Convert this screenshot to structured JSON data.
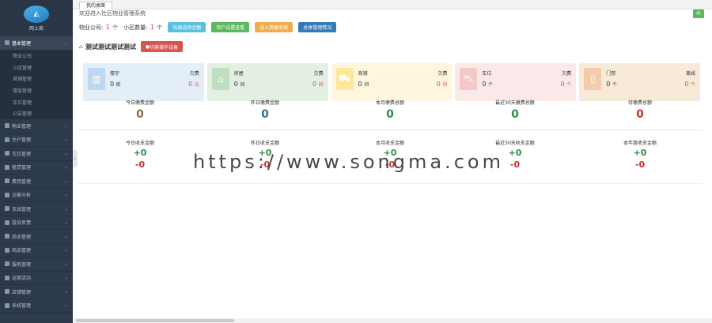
{
  "sidebar": {
    "logo_text": "网上商",
    "items": [
      {
        "label": "基本管理",
        "active": true
      },
      {
        "label": "物业公司",
        "sub": true
      },
      {
        "label": "小区管理",
        "sub": true
      },
      {
        "label": "商铺管理",
        "sub": true
      },
      {
        "label": "楼层管理",
        "sub": true
      },
      {
        "label": "车位管理",
        "sub": true
      },
      {
        "label": "公告管理",
        "sub": true
      },
      {
        "label": "物业管理"
      },
      {
        "label": "住户管理"
      },
      {
        "label": "车位管理"
      },
      {
        "label": "租赁管理"
      },
      {
        "label": "费用管理"
      },
      {
        "label": "访客分析"
      },
      {
        "label": "支出管理"
      },
      {
        "label": "投诉反馈"
      },
      {
        "label": "商业管理"
      },
      {
        "label": "商品管理"
      },
      {
        "label": "服务管理"
      },
      {
        "label": "运营活动"
      },
      {
        "label": "店铺管理"
      },
      {
        "label": "系统管理"
      }
    ]
  },
  "tabs": {
    "home": "我的桌面"
  },
  "header": {
    "welcome": "欢迎进入社区物业管理系统",
    "company_label": "物业公司:",
    "company_count": "1",
    "unit1": "个",
    "community_label": "小区数量:",
    "community_count": "1",
    "unit2": "个",
    "buttons": [
      "快速选择金额",
      "用户设置查看",
      "进入数据系统",
      "总体管理情况"
    ]
  },
  "project": {
    "title": "测试测试测试测试",
    "button": "切换操作设备"
  },
  "cards": [
    {
      "icon": "building-icon",
      "label": "楼宇",
      "value": "0",
      "unit": "栋",
      "label2": "欠费",
      "value2": "0",
      "unit2": "元"
    },
    {
      "icon": "house-icon",
      "label": "房屋",
      "value": "0",
      "unit": "间",
      "label2": "欠费",
      "value2": "0",
      "unit2": "间"
    },
    {
      "icon": "cart-icon",
      "label": "商铺",
      "value": "0",
      "unit": "间",
      "label2": "欠费",
      "value2": "0",
      "unit2": "间"
    },
    {
      "icon": "car-icon",
      "label": "车位",
      "value": "0",
      "unit": "个",
      "label2": "欠费",
      "value2": "0",
      "unit2": "个"
    },
    {
      "icon": "door-icon",
      "label": "门禁",
      "value": "0",
      "unit": "个",
      "label2": "离线",
      "value2": "0",
      "unit2": "个"
    }
  ],
  "counts": [
    {
      "title": "今日缴费金额",
      "value": "0",
      "color": "#8a6d3b"
    },
    {
      "title": "昨日缴费金额",
      "value": "0",
      "color": "#31708f"
    },
    {
      "title": "本月缴费总额",
      "value": "0",
      "color": "#2e8b4a"
    },
    {
      "title": "最近30天缴费总额",
      "value": "0",
      "color": "#2e8b4a"
    },
    {
      "title": "待缴费总额",
      "value": "0",
      "color": "#c9302c"
    }
  ],
  "finance": [
    {
      "title": "今日收支金额",
      "plus": "+0",
      "minus": "-0"
    },
    {
      "title": "昨日收支金额",
      "plus": "+0",
      "minus": "-0"
    },
    {
      "title": "本月收支金额",
      "plus": "+0",
      "minus": "-0"
    },
    {
      "title": "最近30天收支金额",
      "plus": "+0",
      "minus": "-0"
    },
    {
      "title": "本年度收支金额",
      "plus": "+0",
      "minus": "-0"
    }
  ],
  "watermark": "https://www.songma.com"
}
